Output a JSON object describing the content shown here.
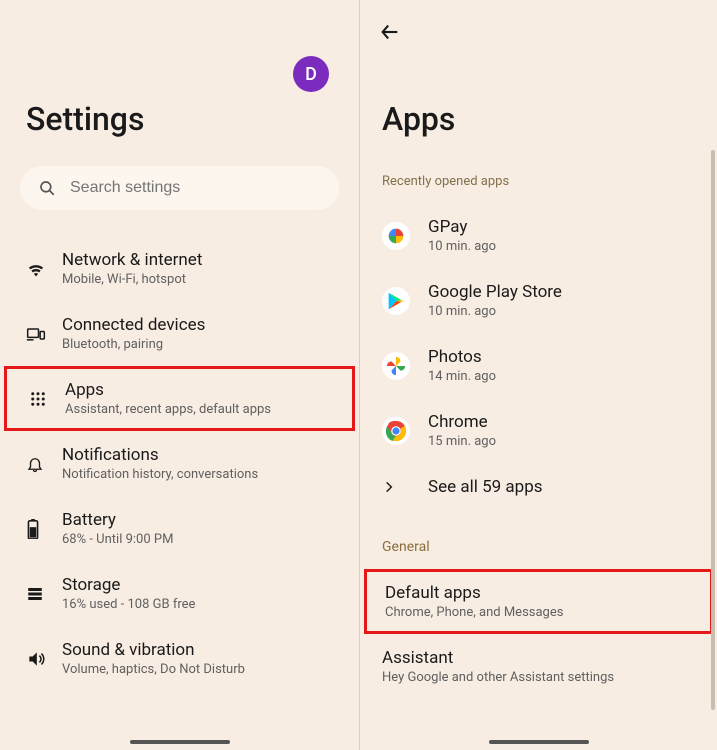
{
  "left": {
    "avatar_letter": "D",
    "title": "Settings",
    "search_placeholder": "Search settings",
    "items": [
      {
        "label": "Network & internet",
        "sub": "Mobile, Wi-Fi, hotspot"
      },
      {
        "label": "Connected devices",
        "sub": "Bluetooth, pairing"
      },
      {
        "label": "Apps",
        "sub": "Assistant, recent apps, default apps"
      },
      {
        "label": "Notifications",
        "sub": "Notification history, conversations"
      },
      {
        "label": "Battery",
        "sub": "68% - Until 9:00 PM"
      },
      {
        "label": "Storage",
        "sub": "16% used - 108 GB free"
      },
      {
        "label": "Sound & vibration",
        "sub": "Volume, haptics, Do Not Disturb"
      }
    ]
  },
  "right": {
    "title": "Apps",
    "recent_label": "Recently opened apps",
    "recent_apps": [
      {
        "name": "GPay",
        "time": "10 min. ago"
      },
      {
        "name": "Google Play Store",
        "time": "10 min. ago"
      },
      {
        "name": "Photos",
        "time": "14 min. ago"
      },
      {
        "name": "Chrome",
        "time": "15 min. ago"
      }
    ],
    "see_all": "See all 59 apps",
    "general_label": "General",
    "general_items": [
      {
        "name": "Default apps",
        "sub": "Chrome, Phone, and Messages"
      },
      {
        "name": "Assistant",
        "sub": "Hey Google and other Assistant settings"
      }
    ]
  }
}
